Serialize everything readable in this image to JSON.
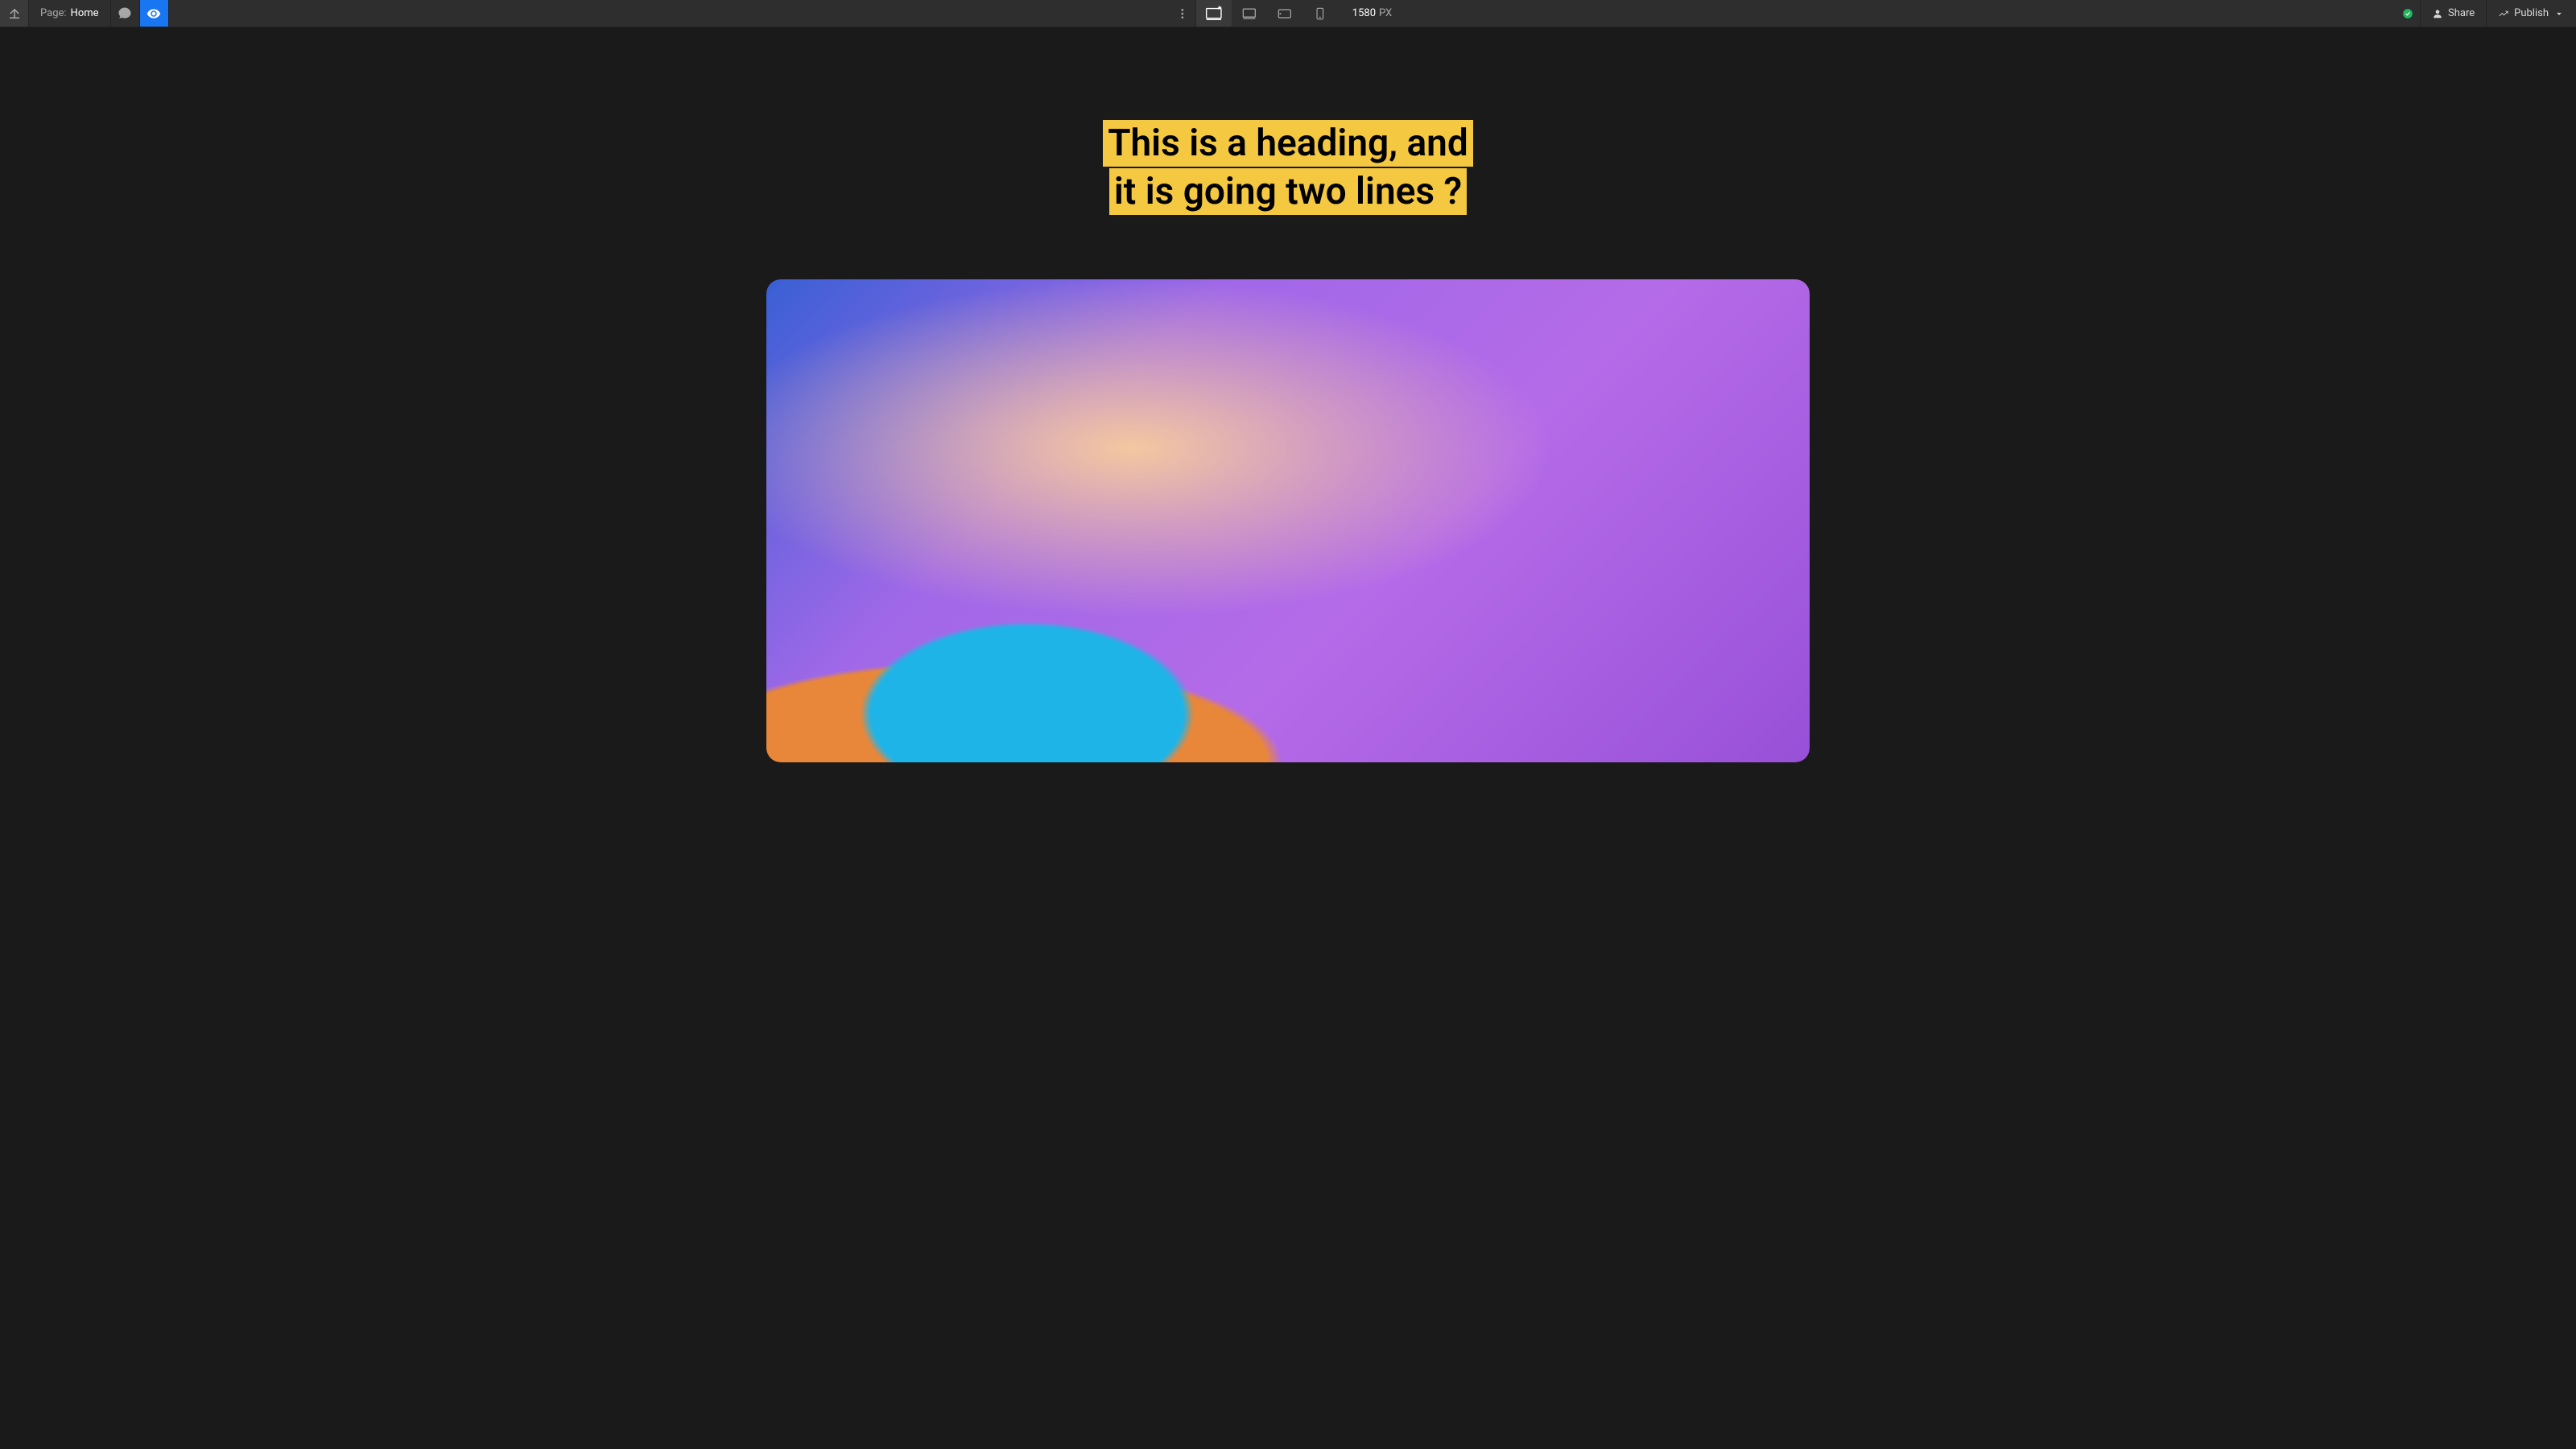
{
  "topbar": {
    "page_label": "Page:",
    "page_value": "Home",
    "viewport_value": "1580",
    "viewport_unit": "PX",
    "share_label": "Share",
    "publish_label": "Publish"
  },
  "icons": {
    "upload": "upload-icon",
    "comments": "comment-icon",
    "preview": "eye-icon",
    "more": "more-vertical-icon",
    "device_desktop_starred": "desktop-star-icon",
    "device_desktop": "desktop-icon",
    "device_tablet": "tablet-icon",
    "device_mobile": "mobile-icon",
    "status_ok": "checkmark-circle-icon",
    "share": "person-icon",
    "publish": "publish-icon",
    "chevron_down": "chevron-down-icon"
  },
  "canvas": {
    "heading_line1": "This is a heading, and",
    "heading_line2": "it is going two lines ?",
    "image_alt": "abstract-gradient-artwork"
  },
  "colors": {
    "highlight": "#f5c842",
    "accent": "#1976f2",
    "status_ok": "#1fb85f",
    "bg_dark": "#1a1a1a",
    "bg_toolbar": "#2e2e2e"
  }
}
